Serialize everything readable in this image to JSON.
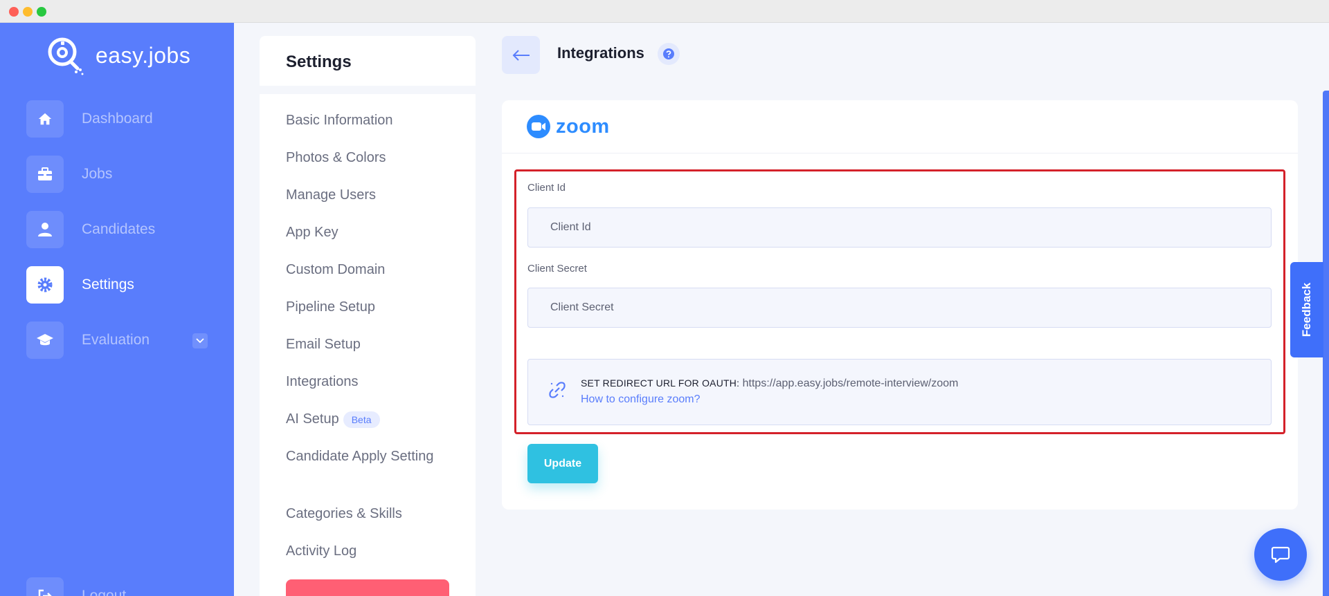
{
  "brand": {
    "name": "easy.jobs",
    "primary_color": "#597dfc",
    "accent_color": "#2fc1e1"
  },
  "sidebar": {
    "items": [
      {
        "label": "Dashboard",
        "icon": "home-icon",
        "active": false
      },
      {
        "label": "Jobs",
        "icon": "briefcase-icon",
        "active": false
      },
      {
        "label": "Candidates",
        "icon": "user-icon",
        "active": false
      },
      {
        "label": "Settings",
        "icon": "gear-icon",
        "active": true
      },
      {
        "label": "Evaluation",
        "icon": "graduation-cap-icon",
        "active": false,
        "has_dropdown": true
      },
      {
        "label": "Logout",
        "icon": "logout-icon",
        "active": false
      }
    ]
  },
  "settings": {
    "title": "Settings",
    "menu": [
      "Basic Information",
      "Photos & Colors",
      "Manage Users",
      "App Key",
      "Custom Domain",
      "Pipeline Setup",
      "Email Setup",
      "Integrations",
      "AI Setup",
      "Candidate Apply Setting",
      "Categories & Skills",
      "Activity Log"
    ],
    "beta_badge": "Beta"
  },
  "page": {
    "title": "Integrations",
    "provider": "zoom",
    "form": {
      "client_id_label": "Client Id",
      "client_id_placeholder": "Client Id",
      "client_secret_label": "Client Secret",
      "client_secret_placeholder": "Client Secret",
      "oauth_label": "SET REDIRECT URL FOR OAUTH:",
      "oauth_url": "https://app.easy.jobs/remote-interview/zoom",
      "help_link": "How to configure zoom?",
      "update_button": "Update"
    }
  },
  "widgets": {
    "feedback_label": "Feedback"
  }
}
